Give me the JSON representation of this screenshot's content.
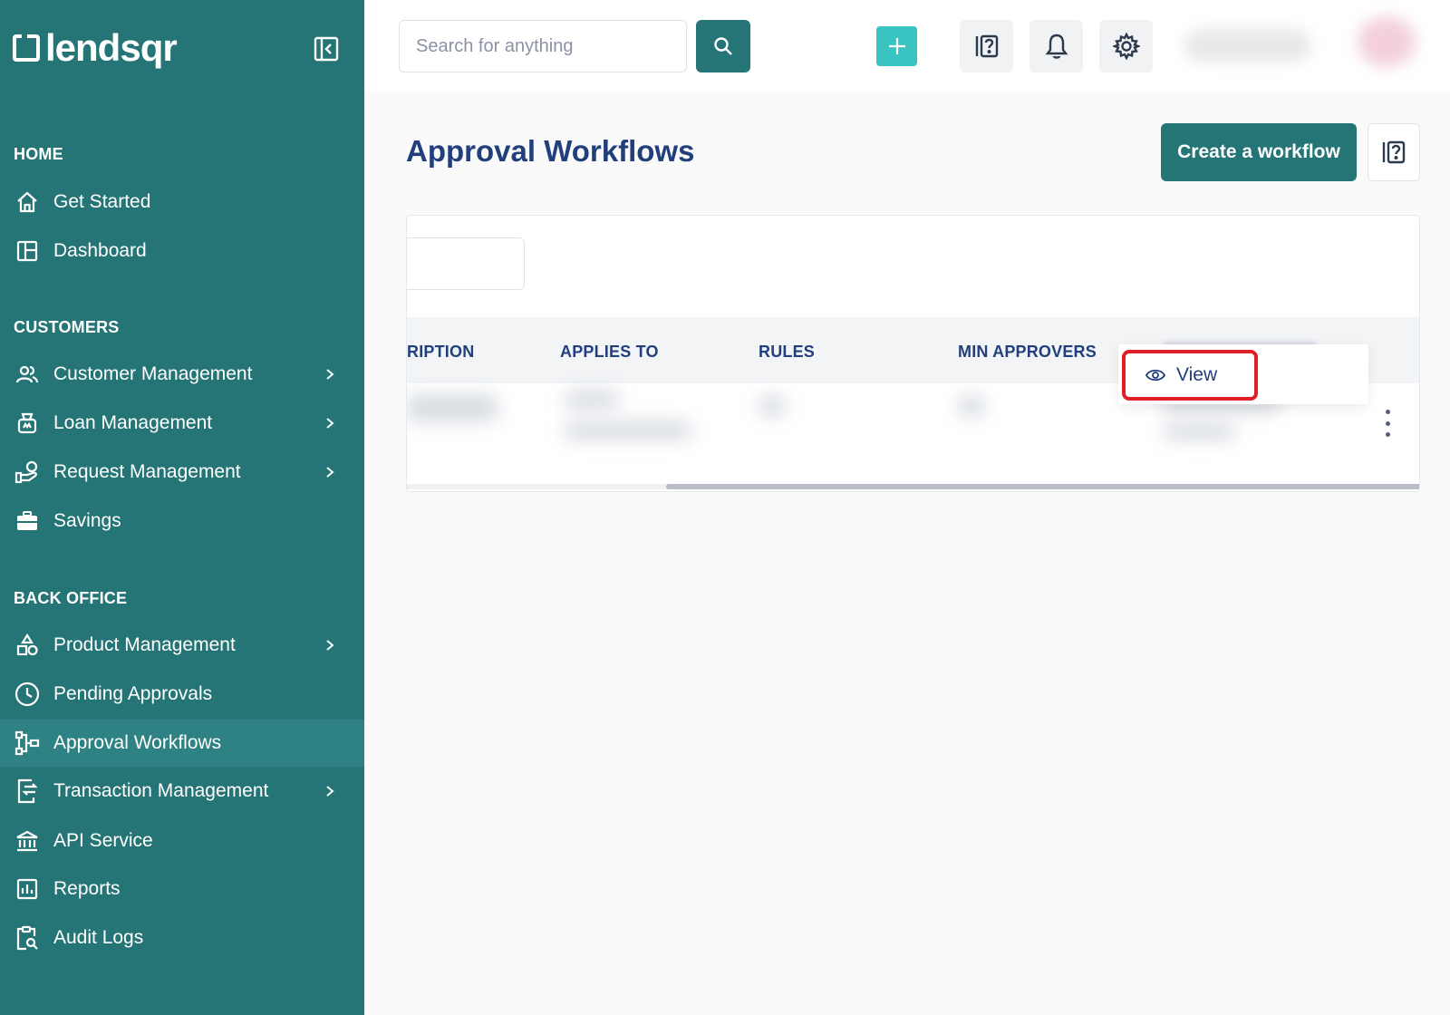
{
  "brand": {
    "name": "lendsqr"
  },
  "sidebar": {
    "sections": [
      {
        "title": "HOME"
      },
      {
        "title": "CUSTOMERS"
      },
      {
        "title": "BACK OFFICE"
      }
    ],
    "items": [
      {
        "label": "Get Started",
        "icon": "home-icon"
      },
      {
        "label": "Dashboard",
        "icon": "dashboard-icon"
      },
      {
        "label": "Customer Management",
        "icon": "users-icon",
        "has_submenu": true
      },
      {
        "label": "Loan Management",
        "icon": "loan-icon",
        "has_submenu": true
      },
      {
        "label": "Request Management",
        "icon": "request-icon",
        "has_submenu": true
      },
      {
        "label": "Savings",
        "icon": "briefcase-icon"
      },
      {
        "label": "Product Management",
        "icon": "shapes-icon",
        "has_submenu": true
      },
      {
        "label": "Pending Approvals",
        "icon": "clock-icon"
      },
      {
        "label": "Approval Workflows",
        "icon": "workflow-icon",
        "active": true
      },
      {
        "label": "Transaction Management",
        "icon": "transaction-icon",
        "has_submenu": true
      },
      {
        "label": "API Service",
        "icon": "bank-icon"
      },
      {
        "label": "Reports",
        "icon": "reports-icon"
      },
      {
        "label": "Audit Logs",
        "icon": "audit-icon"
      }
    ]
  },
  "topbar": {
    "search_placeholder": "Search for anything"
  },
  "main": {
    "title": "Approval Workflows",
    "create_button": "Create a workflow",
    "table": {
      "columns": [
        "RIPTION",
        "APPLIES TO",
        "RULES",
        "MIN APPROVERS"
      ]
    },
    "row_menu": {
      "items": [
        {
          "label": "View",
          "icon": "eye-icon"
        }
      ]
    }
  },
  "colors": {
    "sidebar_bg": "#267576",
    "accent": "#39c4c1",
    "title": "#213f7d",
    "highlight": "#e01e26"
  }
}
